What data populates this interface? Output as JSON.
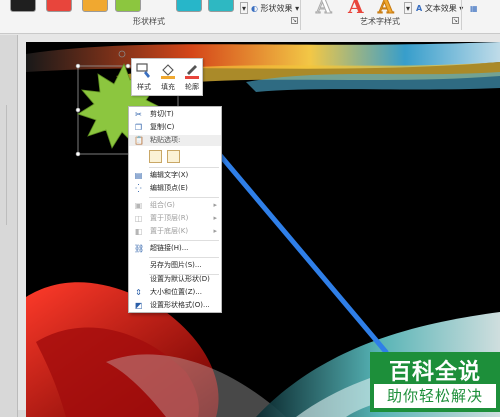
{
  "ribbon": {
    "shape_effects_label": "形状效果",
    "shape_styles_group": "形状样式",
    "wordart_group": "艺术字样式",
    "text_effects_label": "文本效果",
    "wordart_glyph": "A",
    "swatch_colors": [
      "#1f1f1f",
      "#e8453c",
      "#f0a830",
      "#8cc63f",
      "#27b6c9",
      "#2eb8c2"
    ]
  },
  "mini_toolbar": {
    "style_label": "样式",
    "fill_label": "填充",
    "outline_label": "轮廓"
  },
  "context_menu": {
    "cut": "剪切(T)",
    "copy": "复制(C)",
    "paste_options": "粘贴选项:",
    "edit_text": "编辑文字(X)",
    "edit_points": "编辑顶点(E)",
    "group": "组合(G)",
    "bring_to_front": "置于顶层(R)",
    "send_to_back": "置于底层(K)",
    "hyperlink": "超链接(H)...",
    "save_as_picture": "另存为图片(S)...",
    "set_default_shape": "设置为默认形状(D)",
    "size_position": "大小和位置(Z)...",
    "format_shape": "设置形状格式(O)..."
  },
  "watermark": {
    "title": "百科全说",
    "subtitle": "助你轻松解决"
  },
  "colors": {
    "starburst": "#8cc63f",
    "arrow": "#2f7fe8",
    "watermark_green": "#1d8f3a"
  }
}
